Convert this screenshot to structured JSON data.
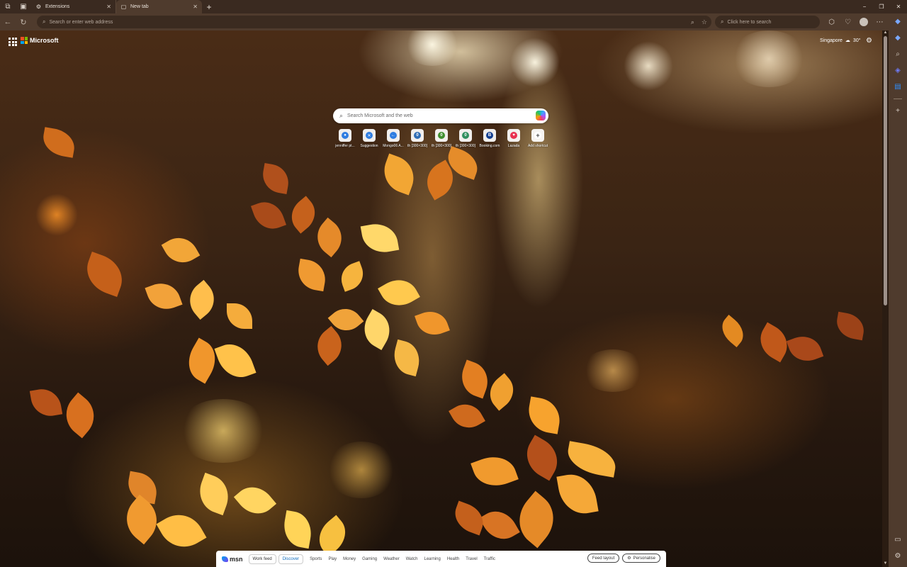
{
  "tabs": [
    {
      "title": "Extensions",
      "active": false,
      "icon": "gear-icon"
    },
    {
      "title": "New tab",
      "active": true,
      "icon": "newtab-page-icon"
    }
  ],
  "window_controls": {
    "minimize": "−",
    "restore": "❐",
    "close": "✕"
  },
  "toolbar": {
    "address_placeholder": "Search or enter web address",
    "secondary_search_placeholder": "Click here to search"
  },
  "page": {
    "brand": "Microsoft",
    "weather": {
      "location": "Singapore",
      "temp": "30°",
      "icon": "cloud-icon"
    },
    "search_placeholder": "Search Microsoft and the web",
    "quick_links": [
      {
        "label": "jenniffer pt...",
        "color": "#2f7de1",
        "glyph": "●"
      },
      {
        "label": "Suggestion",
        "color": "#2f7de1",
        "glyph": "✕"
      },
      {
        "label": "Mongo06 A...",
        "color": "#2f7de1",
        "glyph": "←"
      },
      {
        "label": "th [300×300]",
        "color": "#2f6db5",
        "glyph": "0"
      },
      {
        "label": "th [300×300]",
        "color": "#3f8f2f",
        "glyph": "0"
      },
      {
        "label": "th [300×300]",
        "color": "#2f8f5f",
        "glyph": "0"
      },
      {
        "label": "Booking.com",
        "color": "#113d8f",
        "glyph": "B"
      },
      {
        "label": "Lazada",
        "color": "#e8304f",
        "glyph": "♥"
      },
      {
        "label": "Add shortcut",
        "color": "#ffffff",
        "glyph": "+"
      }
    ]
  },
  "msn": {
    "logo": "msn",
    "pill_tabs": [
      "Work feed",
      "Discover"
    ],
    "nav": [
      "Sports",
      "Play",
      "Money",
      "Gaming",
      "Weather",
      "Watch",
      "Learning",
      "Health",
      "Travel",
      "Traffic"
    ],
    "feed_layout": "Feed layout",
    "personalise": "Personalise"
  },
  "colors": {
    "chrome_bg": "#4f3b2d",
    "tabbar_bg": "#3a2a20",
    "accent": "#0f6cbd"
  }
}
